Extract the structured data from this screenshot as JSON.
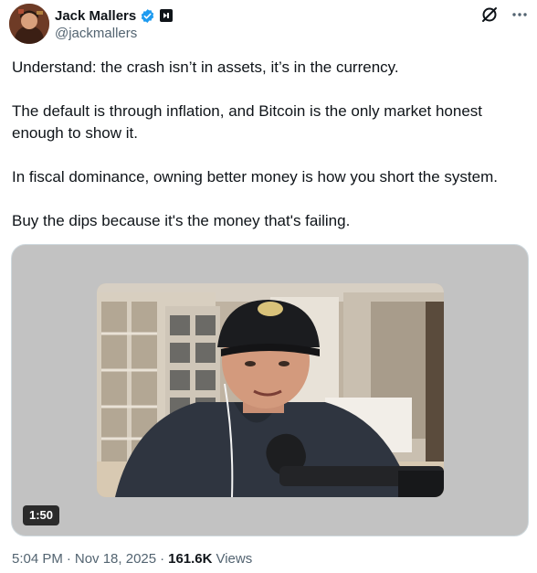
{
  "author": {
    "display_name": "Jack Mallers",
    "handle": "@jackmallers"
  },
  "tweet": {
    "paragraphs": [
      "Understand: the crash isn’t in assets, it’s in the currency.",
      "The default is through inflation, and Bitcoin is the only market honest enough to show it.",
      "In fiscal dominance, owning better money is how you short the system.",
      "Buy the dips because it's the money that's failing."
    ]
  },
  "media": {
    "duration": "1:50"
  },
  "meta": {
    "time": "5:04 PM",
    "date": "Nov 18, 2025",
    "views_count": "161.6K",
    "views_label": "Views"
  },
  "colors": {
    "verified_blue": "#1d9bf0",
    "secondary_text": "#536471",
    "media_background": "#c2c2c2"
  },
  "icons": [
    "verified-badge-icon",
    "affiliate-badge-icon",
    "grok-icon",
    "more-options-icon"
  ]
}
